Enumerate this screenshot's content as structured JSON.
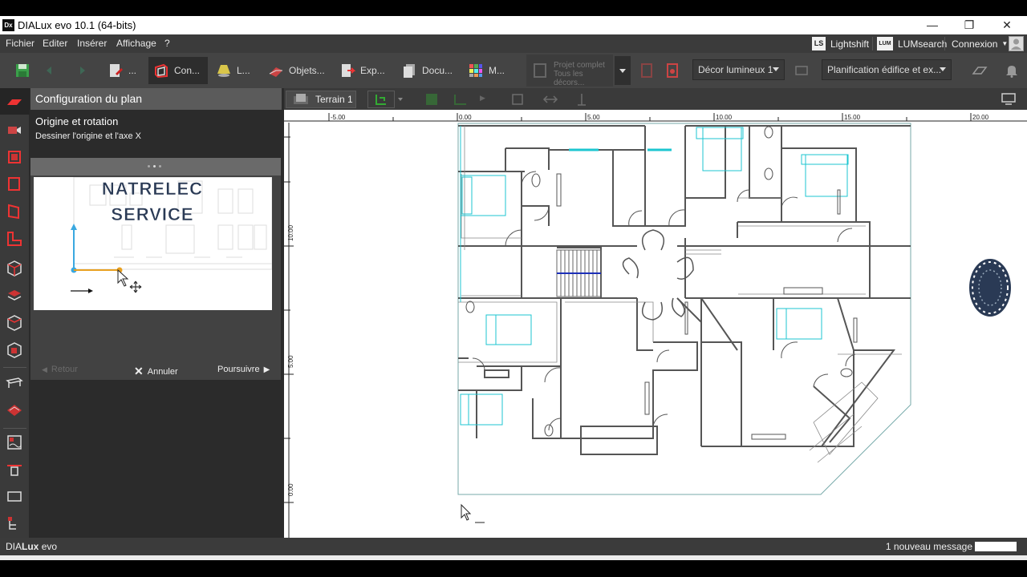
{
  "window": {
    "title": "DIALux evo 10.1  (64-bits)",
    "logo_text": "Dx",
    "minimize": "—",
    "restore": "❐",
    "close": "✕"
  },
  "menu": {
    "items": [
      "Fichier",
      "Editer",
      "Insérer",
      "Affichage",
      "?"
    ],
    "lightshift_badge": "LS",
    "lightshift": "Lightshift",
    "lumsearch_badge": "LUM",
    "lumsearch": "LUMsearch",
    "connexion": "Connexion"
  },
  "toolbar": {
    "tabs": [
      "...",
      "Con...",
      "L...",
      "Objets...",
      "Exp...",
      "Docu...",
      "M..."
    ],
    "projet_line1": "Projet complet",
    "projet_line2": "Tous les décors...",
    "decor": "Décor lumineux 1",
    "planification": "Planification édifice et ex..."
  },
  "panel": {
    "header": "Configuration du plan",
    "subtitle": "Origine et rotation",
    "instruction": "Dessiner l'origine et l'axe X",
    "watermark_line1": "NATRELEC",
    "watermark_line2": "SERVICE",
    "back": "Retour",
    "cancel": "Annuler",
    "next": "Poursuivre"
  },
  "canvas": {
    "terrain": "Terrain 1",
    "ruler_x": [
      "-5.00",
      "0.00",
      "5.00",
      "10.00",
      "15.00",
      "20.00"
    ],
    "ruler_y": [
      "10.00",
      "5.00",
      "0.00"
    ]
  },
  "status": {
    "brand_a": "DIA",
    "brand_b": "Lux",
    "brand_c": " evo",
    "message": "1 nouveau message"
  },
  "colors": {
    "accent_cyan": "#1cc6d0",
    "stair_blue": "#1c2fb8",
    "origin_orange": "#e8a020",
    "origin_blue": "#3aa8e0"
  }
}
